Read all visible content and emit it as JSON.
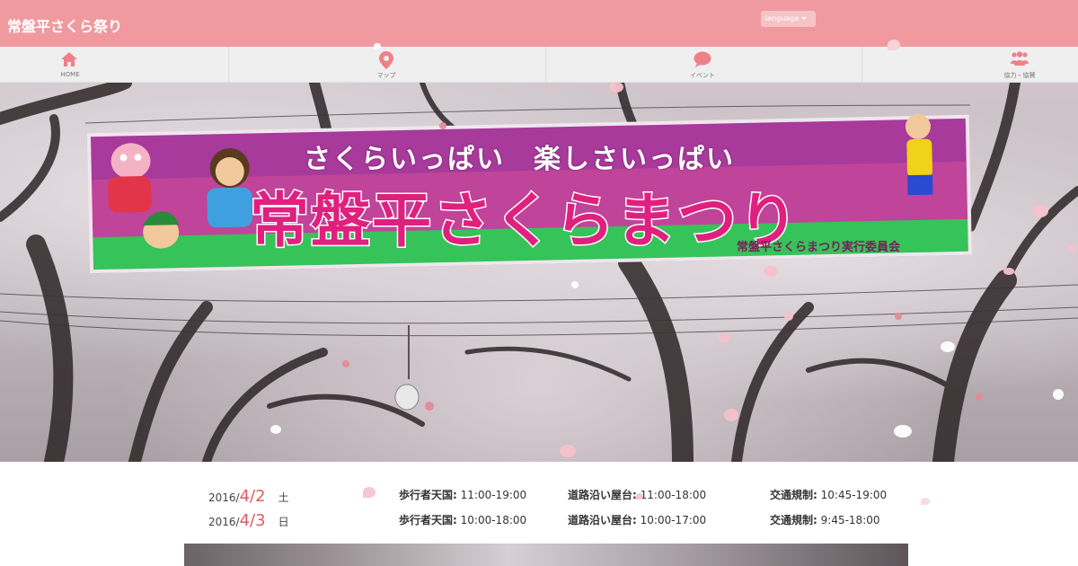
{
  "header": {
    "site_title": "常盤平さくら祭り",
    "language_label": "language"
  },
  "nav": {
    "items": [
      {
        "label": "HOME",
        "icon": "home-icon"
      },
      {
        "label": "マップ",
        "icon": "map-pin-icon"
      },
      {
        "label": "イベント",
        "icon": "speech-bubble-icon"
      },
      {
        "label": "協力・協賛",
        "icon": "people-icon"
      }
    ]
  },
  "hero": {
    "banner": {
      "slogan": "さくらいっぱい　楽しさいっぱい",
      "title": "常盤平さくらまつり",
      "organizer": "常盤平さくらまつり実行委員会"
    }
  },
  "schedule": [
    {
      "year": "2016/",
      "month_day": "4/2",
      "weekday": "土",
      "pedestrian_label": "歩行者天国:",
      "pedestrian_time": "11:00-19:00",
      "stalls_label": "道路沿い屋台:",
      "stalls_time": "11:00-18:00",
      "traffic_label": "交通規制:",
      "traffic_time": "10:45-19:00"
    },
    {
      "year": "2016/",
      "month_day": "4/3",
      "weekday": "日",
      "pedestrian_label": "歩行者天国:",
      "pedestrian_time": "10:00-18:00",
      "stalls_label": "道路沿い屋台:",
      "stalls_time": "10:00-17:00",
      "traffic_label": "交通規制:",
      "traffic_time": "9:45-18:00"
    }
  ],
  "colors": {
    "header_bg": "#f09aa0",
    "accent_date": "#e05a64",
    "banner_pink": "#c03c9a",
    "banner_green": "#34c45a"
  }
}
